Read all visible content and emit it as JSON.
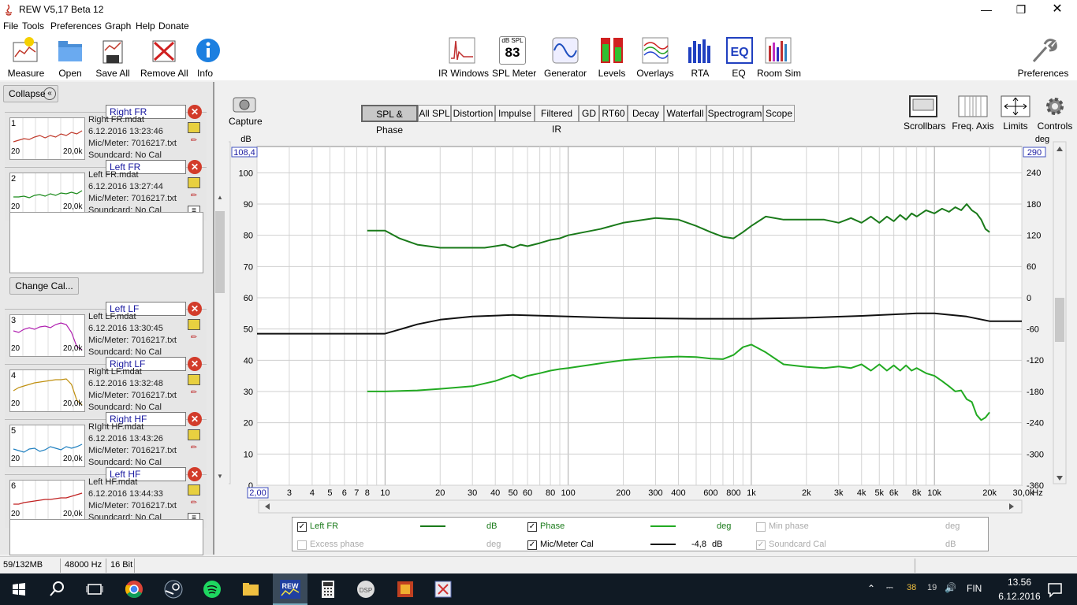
{
  "window": {
    "title": "REW V5,17 Beta 12"
  },
  "menu": [
    "File",
    "Tools",
    "Preferences",
    "Graph",
    "Help",
    "Donate"
  ],
  "toolbar": {
    "left": [
      "Measure",
      "Open",
      "Save All",
      "Remove All",
      "Info"
    ],
    "center": [
      "IR Windows",
      "SPL Meter",
      "Generator",
      "Levels",
      "Overlays",
      "RTA",
      "EQ",
      "Room Sim"
    ],
    "spl_meter_label": "dB SPL",
    "spl_meter_value": "83",
    "right": "Preferences"
  },
  "sidebar": {
    "collapse_label": "Collapse",
    "change_cal_label": "Change Cal...",
    "measurements": [
      {
        "num": "1",
        "name": "Right FR",
        "file": "Right FR.mdat",
        "date": "6.12.2016 13:23:46",
        "mic": "Mic/Meter: 7016217.txt",
        "sc": "Soundcard: No Cal",
        "color": "#c0392b",
        "xmin": "20",
        "xmax": "20,0k"
      },
      {
        "num": "2",
        "name": "Left FR",
        "file": "Left FR.mdat",
        "date": "6.12.2016 13:27:44",
        "mic": "Mic/Meter: 7016217.txt",
        "sc": "Soundcard: No Cal",
        "color": "#1a8a1a",
        "xmin": "20",
        "xmax": "20,0k"
      },
      {
        "num": "3",
        "name": "Left LF",
        "file": "Left LF.mdat",
        "date": "6.12.2016 13:30:45",
        "mic": "Mic/Meter: 7016217.txt",
        "sc": "Soundcard: No Cal",
        "color": "#b020b0",
        "xmin": "20",
        "xmax": "20,0k"
      },
      {
        "num": "4",
        "name": "Right LF",
        "file": "Right LF.mdat",
        "date": "6.12.2016 13:32:48",
        "mic": "Mic/Meter: 7016217.txt",
        "sc": "Soundcard: No Cal",
        "color": "#c09010",
        "xmin": "20",
        "xmax": "20,0k"
      },
      {
        "num": "5",
        "name": "Right HF",
        "file": "RIght HF.mdat",
        "date": "6.12.2016 13:43:26",
        "mic": "Mic/Meter: 7016217.txt",
        "sc": "Soundcard: No Cal",
        "color": "#2080c0",
        "xmin": "20",
        "xmax": "20,0k"
      },
      {
        "num": "6",
        "name": "Left HF",
        "file": "Left HF.mdat",
        "date": "6.12.2016 13:44:33",
        "mic": "Mic/Meter: 7016217.txt",
        "sc": "Soundcard: No Cal",
        "color": "#c02020",
        "xmin": "20",
        "xmax": "20,0k"
      }
    ]
  },
  "graph_controls": {
    "capture": "Capture",
    "right_tools": [
      "Scrollbars",
      "Freq. Axis",
      "Limits",
      "Controls"
    ]
  },
  "graph_tabs": [
    "SPL & Phase",
    "All SPL",
    "Distortion",
    "Impulse",
    "Filtered IR",
    "GD",
    "RT60",
    "Decay",
    "Waterfall",
    "Spectrogram",
    "Scope"
  ],
  "active_tab": "SPL & Phase",
  "chart_data": {
    "type": "line",
    "title": "",
    "ylabel": "dB",
    "y2label": "deg",
    "xlabel": "",
    "x_scale": "log",
    "xlim": [
      2,
      30000
    ],
    "ylim": [
      0,
      108.4
    ],
    "y2lim": [
      -360,
      290
    ],
    "x_unit": "Hz",
    "x_min_label": "2,00",
    "y_max_label": "108,4",
    "y2_max_label": "290",
    "x_ticks": [
      "3",
      "4",
      "5",
      "6",
      "7",
      "8",
      "10",
      "20",
      "30",
      "40",
      "50",
      "60",
      "80",
      "100",
      "200",
      "300",
      "400",
      "600",
      "800",
      "1k",
      "2k",
      "3k",
      "4k",
      "5k",
      "6k",
      "8k",
      "10k",
      "20k",
      "30,0k"
    ],
    "y_ticks": [
      "100",
      "90",
      "80",
      "70",
      "60",
      "50",
      "40",
      "30",
      "20",
      "10",
      "0"
    ],
    "y2_ticks": [
      "240",
      "180",
      "120",
      "60",
      "0",
      "-60",
      "-120",
      "-180",
      "-240",
      "-300",
      "-360"
    ],
    "series": [
      {
        "name": "Left FR",
        "axis": "dB",
        "color": "#1a7a1a",
        "x": [
          8,
          10,
          12,
          15,
          20,
          25,
          30,
          35,
          40,
          45,
          50,
          55,
          60,
          70,
          80,
          90,
          100,
          150,
          200,
          300,
          400,
          500,
          600,
          700,
          800,
          900,
          1000,
          1200,
          1500,
          2000,
          2500,
          3000,
          3500,
          4000,
          4500,
          5000,
          5500,
          6000,
          6500,
          7000,
          7500,
          8000,
          9000,
          10000,
          11000,
          12000,
          13000,
          14000,
          15000,
          16000,
          17000,
          18000,
          19000,
          20000
        ],
        "y": [
          81.5,
          81.5,
          79,
          77,
          76,
          76,
          76,
          76,
          76.5,
          77,
          76,
          77,
          76.5,
          77.5,
          78.5,
          79,
          80,
          82,
          84,
          85.5,
          85,
          83,
          81,
          79.5,
          79,
          81,
          83,
          86,
          85,
          85,
          85,
          84,
          85.5,
          84,
          86,
          84,
          86,
          84.5,
          86.5,
          85,
          87,
          86,
          88,
          87,
          88.5,
          87.5,
          89,
          88,
          90,
          88,
          87,
          85,
          82,
          81
        ]
      },
      {
        "name": "Phase",
        "axis": "deg",
        "color": "#22aa22",
        "x": [
          8,
          10,
          15,
          20,
          30,
          40,
          50,
          55,
          60,
          70,
          80,
          90,
          100,
          150,
          200,
          300,
          400,
          500,
          600,
          700,
          800,
          900,
          1000,
          1200,
          1500,
          2000,
          2500,
          3000,
          3500,
          4000,
          4500,
          5000,
          5500,
          6000,
          6500,
          7000,
          7500,
          8000,
          9000,
          10000,
          11000,
          12000,
          13000,
          14000,
          15000,
          16000,
          17000,
          18000,
          19000,
          20000
        ],
        "y": [
          -180,
          -180,
          -178,
          -175,
          -170,
          -160,
          -148,
          -155,
          -150,
          -145,
          -140,
          -137,
          -135,
          -126,
          -120,
          -115,
          -113,
          -114,
          -117,
          -118,
          -110,
          -95,
          -90,
          -105,
          -128,
          -133,
          -135,
          -132,
          -135,
          -128,
          -140,
          -128,
          -140,
          -130,
          -140,
          -130,
          -140,
          -135,
          -145,
          -150,
          -160,
          -170,
          -180,
          -178,
          -195,
          -200,
          -225,
          -235,
          -230,
          -220
        ]
      },
      {
        "name": "Mic/Meter Cal",
        "axis": "dB",
        "color": "#111111",
        "x": [
          2,
          10,
          15,
          20,
          30,
          50,
          100,
          200,
          500,
          1000,
          2000,
          4000,
          8000,
          10000,
          15000,
          20000,
          30000
        ],
        "y": [
          48.5,
          48.5,
          51.5,
          53,
          54,
          54.5,
          54,
          53.5,
          53.3,
          53.3,
          53.6,
          54.2,
          55,
          55,
          54,
          52.5,
          52.5
        ]
      }
    ]
  },
  "legend": {
    "items": [
      {
        "label": "Left FR",
        "checked": true,
        "enabled": true,
        "unit": "dB",
        "value": "",
        "color": "#1a7a1a"
      },
      {
        "label": "Phase",
        "checked": true,
        "enabled": true,
        "unit": "deg",
        "value": "",
        "color": "#22aa22"
      },
      {
        "label": "Min phase",
        "checked": false,
        "enabled": false,
        "unit": "deg",
        "value": "",
        "color": ""
      },
      {
        "label": "Excess phase",
        "checked": false,
        "enabled": false,
        "unit": "deg",
        "value": "",
        "color": ""
      },
      {
        "label": "Mic/Meter Cal",
        "checked": true,
        "enabled": true,
        "unit": "dB",
        "value": "-4,8",
        "color": "#111111"
      },
      {
        "label": "Soundcard Cal",
        "checked": true,
        "enabled": false,
        "unit": "dB",
        "value": "",
        "color": ""
      }
    ]
  },
  "status": {
    "memory": "59/132MB",
    "rate": "48000 Hz",
    "bits": "16 Bit"
  },
  "taskbar": {
    "lang": "FIN",
    "time": "13.56",
    "date": "6.12.2016",
    "tray_temp": "38",
    "tray_num": "19"
  }
}
